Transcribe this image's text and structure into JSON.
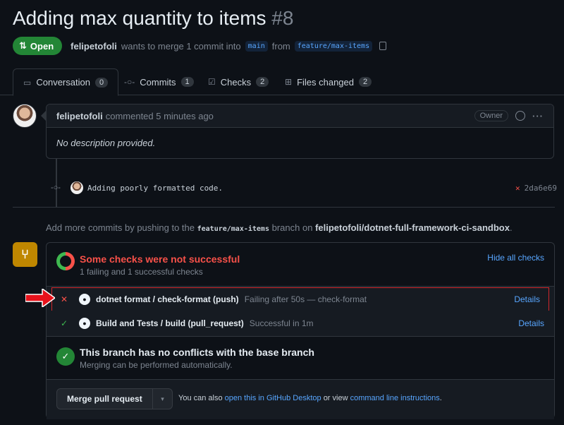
{
  "header": {
    "title": "Adding max quantity to items",
    "number": "#8",
    "state": "Open",
    "author": "felipetofoli",
    "merge_text": "wants to merge 1 commit into",
    "base_branch": "main",
    "from_text": "from",
    "head_branch": "feature/max-items"
  },
  "tabs": [
    {
      "label": "Conversation",
      "count": "0"
    },
    {
      "label": "Commits",
      "count": "1"
    },
    {
      "label": "Checks",
      "count": "2"
    },
    {
      "label": "Files changed",
      "count": "2"
    }
  ],
  "comment": {
    "author": "felipetofoli",
    "action": "commented 5 minutes ago",
    "role": "Owner",
    "body": "No description provided."
  },
  "commit": {
    "message": "Adding poorly formatted code.",
    "sha": "2da6e69"
  },
  "hint": {
    "prefix": "Add more commits by pushing to the",
    "branch": "feature/max-items",
    "middle": "branch on",
    "repo": "felipetofoli/dotnet-full-framework-ci-sandbox",
    "suffix": "."
  },
  "checks": {
    "title": "Some checks were not successful",
    "subtitle": "1 failing and 1 successful checks",
    "hide_label": "Hide all checks",
    "items": [
      {
        "status": "fail",
        "name": "dotnet format / check-format (push)",
        "desc": "Failing after 50s — check-format",
        "link": "Details"
      },
      {
        "status": "success",
        "name": "Build and Tests / build (pull_request)",
        "desc": "Successful in 1m",
        "link": "Details"
      }
    ]
  },
  "conflict": {
    "title": "This branch has no conflicts with the base branch",
    "subtitle": "Merging can be performed automatically."
  },
  "merge": {
    "button": "Merge pull request",
    "note_prefix": "You can also",
    "desktop_link": "open this in GitHub Desktop",
    "note_middle": "or view",
    "cli_link": "command line instructions",
    "note_suffix": "."
  },
  "colors": {
    "open_green": "#238636",
    "fail_red": "#f85149",
    "link_blue": "#58a6ff",
    "merge_yellow": "#bf8700",
    "highlight_red": "#d0272c"
  }
}
